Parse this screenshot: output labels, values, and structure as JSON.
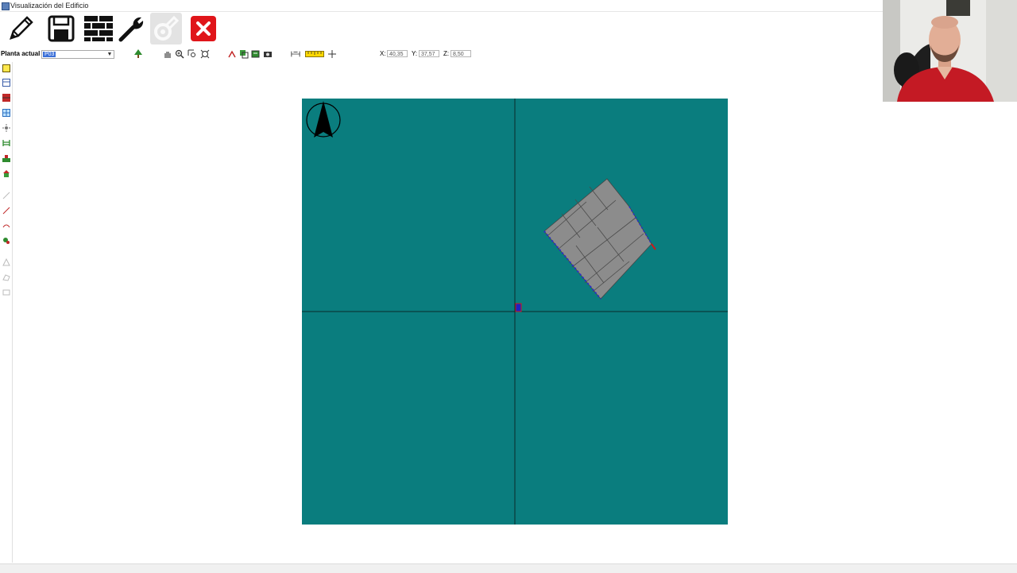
{
  "window": {
    "title": "Visualización del Edificio"
  },
  "toolbar": {
    "buttons": [
      {
        "name": "pencil-icon",
        "label": "Editar"
      },
      {
        "name": "save-icon",
        "label": "Guardar"
      },
      {
        "name": "brick-wall-icon",
        "label": "Muros"
      },
      {
        "name": "wrench-icon",
        "label": "Herramientas"
      },
      {
        "name": "gear-disabled-icon",
        "label": "Configuración"
      },
      {
        "name": "close-icon",
        "label": "Cerrar"
      }
    ]
  },
  "floor": {
    "label": "Planta actual",
    "selected": "P03"
  },
  "coords": {
    "x_label": "X:",
    "x_value": "40,35",
    "y_label": "Y:",
    "y_value": "37,57",
    "z_label": "Z:",
    "z_value": "8,50"
  },
  "colors": {
    "canvas": "#0a7d7e",
    "building": "#8c8c8c",
    "origin_marker": "#2020c0",
    "close_button": "#e0151a"
  }
}
